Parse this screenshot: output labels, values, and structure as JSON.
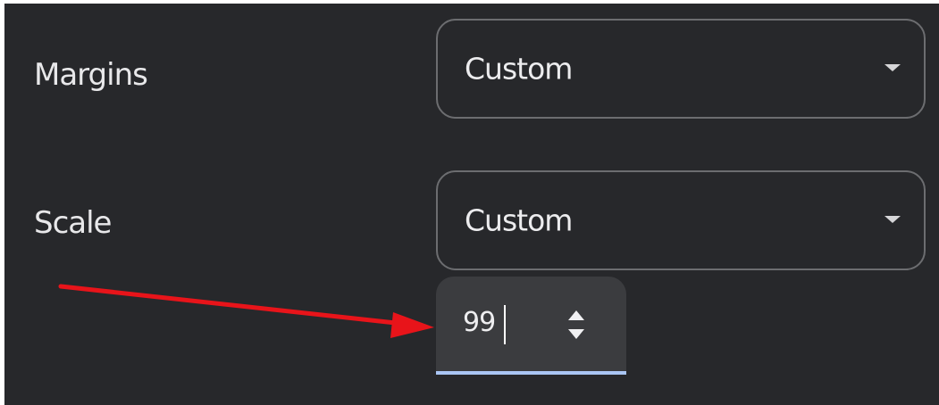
{
  "margins": {
    "label": "Margins",
    "selected": "Custom"
  },
  "scale": {
    "label": "Scale",
    "selected": "Custom",
    "stepper_value": "99"
  },
  "icons": {
    "dropdown": "chevron-down-icon",
    "spinner": "up-down-spinner-icon",
    "annotation": "red-arrow-icon"
  },
  "colors": {
    "background": "#27282b",
    "focus_underline": "#aac6f4",
    "annotation_arrow": "#e8141a"
  }
}
